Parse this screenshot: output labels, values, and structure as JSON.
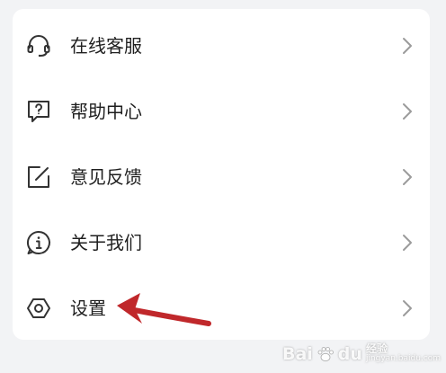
{
  "menu": {
    "items": [
      {
        "label": "在线客服",
        "icon": "headset-icon"
      },
      {
        "label": "帮助中心",
        "icon": "help-question-icon"
      },
      {
        "label": "意见反馈",
        "icon": "feedback-edit-icon"
      },
      {
        "label": "关于我们",
        "icon": "info-icon"
      },
      {
        "label": "设置",
        "icon": "settings-hexagon-icon"
      }
    ]
  },
  "annotation": {
    "arrow_color": "#c0282b"
  },
  "watermark": {
    "brand": "Bai",
    "brand2": "du",
    "cn": "经验",
    "url": "jingyan.baidu.com"
  },
  "colors": {
    "background": "#f2f3f5",
    "card": "#ffffff",
    "text": "#1f1f1f",
    "icon": "#333333",
    "chevron": "#9b9b9b"
  }
}
